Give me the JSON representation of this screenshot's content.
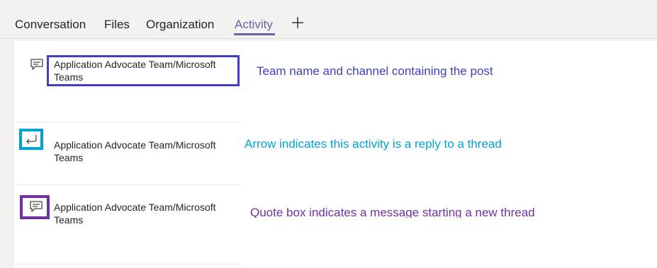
{
  "tabs": {
    "conversation": "Conversation",
    "files": "Files",
    "organization": "Organization",
    "activity": "Activity"
  },
  "items": [
    {
      "line1": "Application Advocate Team/Microsoft",
      "line2": "Teams",
      "icon": "chat-bubble-icon"
    },
    {
      "line1": "Application Advocate Team/Microsoft",
      "line2": "Teams",
      "icon": "reply-arrow-icon"
    },
    {
      "line1": "Application Advocate Team/Microsoft",
      "line2": "Teams",
      "icon": "chat-bubble-icon"
    }
  ],
  "annotations": {
    "team_channel": "Team name and channel containing the post",
    "reply_arrow": "Arrow indicates this activity is a reply to a thread",
    "quote_box": "Quote box indicates a message starting a new thread"
  },
  "colors": {
    "accent": "#6264a7",
    "annotation_blue": "#3f3fbf",
    "annotation_cyan": "#00a2d6",
    "annotation_purple": "#7030a0"
  }
}
